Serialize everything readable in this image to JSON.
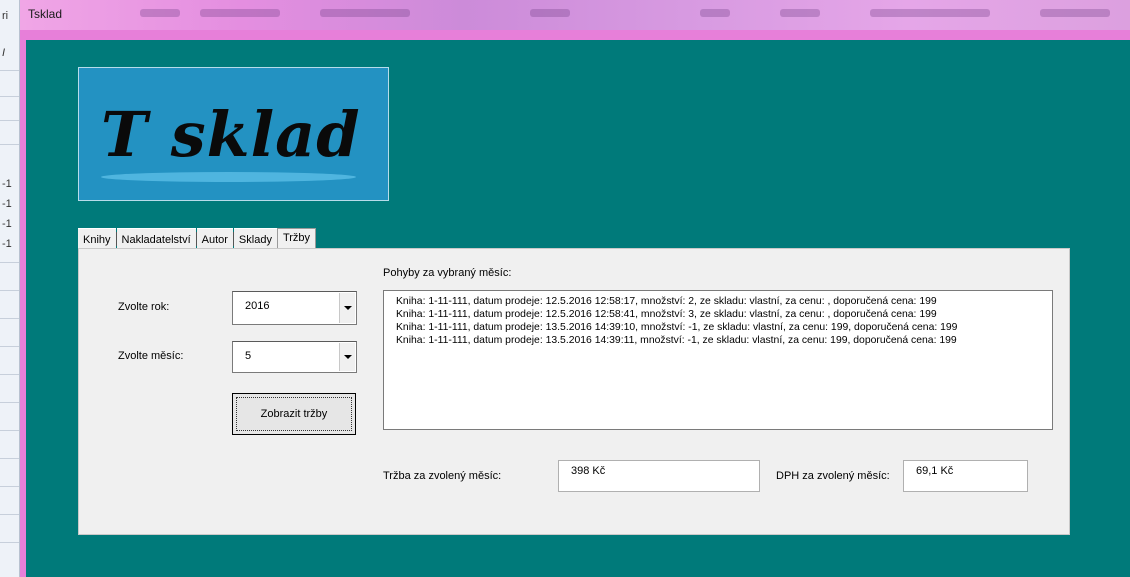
{
  "window": {
    "title": "Tsklad"
  },
  "background_app": {
    "strip_texts": [
      "ri",
      "I",
      "-1",
      "-1",
      "-1",
      "-1"
    ]
  },
  "logo": {
    "text": "T sklad"
  },
  "tabs": [
    {
      "label": "Knihy",
      "active": false
    },
    {
      "label": "Nakladatelství",
      "active": false
    },
    {
      "label": "Autor",
      "active": false
    },
    {
      "label": "Sklady",
      "active": false
    },
    {
      "label": "Tržby",
      "active": true
    }
  ],
  "form": {
    "year_label": "Zvolte rok:",
    "year_value": "2016",
    "month_label": "Zvolte měsíc:",
    "month_value": "5",
    "show_button_label": "Zobrazit tržby",
    "moves_label": "Pohyby za vybraný měsíc:",
    "moves": [
      "Kniha: 1-11-111, datum prodeje: 12.5.2016 12:58:17, množství: 2, ze skladu: vlastní, za cenu: , doporučená cena: 199",
      "Kniha: 1-11-111, datum prodeje: 12.5.2016 12:58:41, množství: 3, ze skladu: vlastní, za cenu: , doporučená cena: 199",
      "Kniha: 1-11-111, datum prodeje: 13.5.2016 14:39:10, množství: -1, ze skladu: vlastní, za cenu: 199, doporučená cena: 199",
      "Kniha: 1-11-111, datum prodeje: 13.5.2016 14:39:11, množství: -1, ze skladu: vlastní, za cenu: 199, doporučená cena: 199"
    ],
    "revenue_label": "Tržba za zvolený měsíc:",
    "revenue_value": "398 Kč",
    "vat_label": "DPH za zvolený měsíc:",
    "vat_value": "69,1 Kč"
  },
  "colors": {
    "client_background": "#007a7a",
    "window_frame": "#e77fd9",
    "logo_background": "#2392c2",
    "panel_background": "#f0f0f0"
  }
}
